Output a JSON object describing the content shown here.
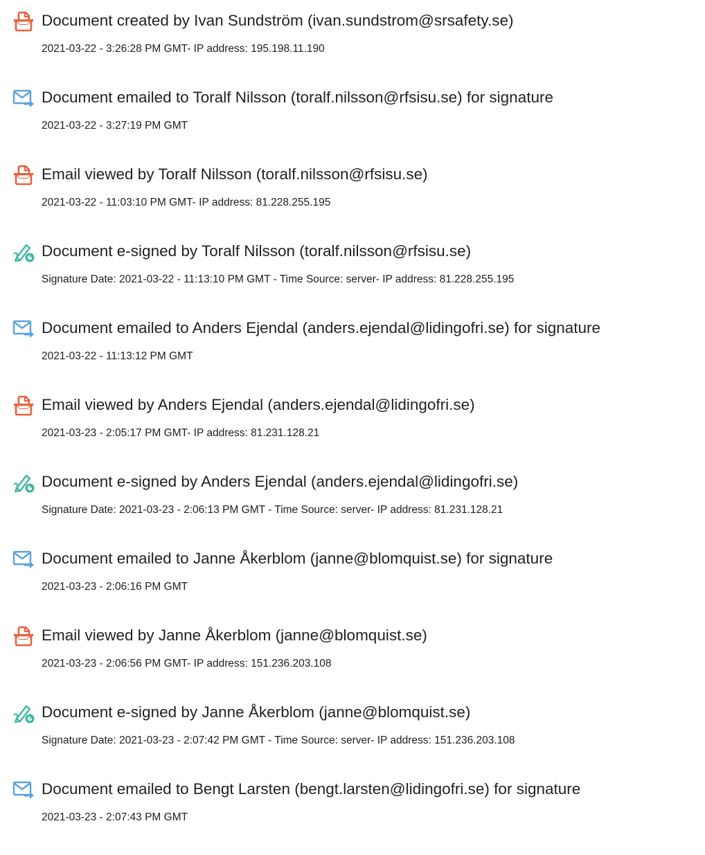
{
  "colors": {
    "created_icon": "#e8603c",
    "emailed_icon": "#5aa3dd",
    "signed_icon": "#3fb6a1",
    "text": "#222222"
  },
  "events": [
    {
      "type": "created",
      "icon": "document-created-icon",
      "title": "Document created by Ivan Sundström (ivan.sundstrom@srsafety.se)",
      "detail": "2021-03-22 - 3:26:28 PM GMT- IP address: 195.198.11.190"
    },
    {
      "type": "emailed",
      "icon": "envelope-arrow-icon",
      "title": "Document emailed to Toralf Nilsson (toralf.nilsson@rfsisu.se) for signature",
      "detail": "2021-03-22 - 3:27:19 PM GMT"
    },
    {
      "type": "viewed",
      "icon": "document-viewed-icon",
      "title": "Email viewed by Toralf Nilsson (toralf.nilsson@rfsisu.se)",
      "detail": "2021-03-22 - 11:03:10 PM GMT- IP address: 81.228.255.195"
    },
    {
      "type": "signed",
      "icon": "pen-signed-icon",
      "title": "Document e-signed by Toralf Nilsson (toralf.nilsson@rfsisu.se)",
      "detail": "Signature Date: 2021-03-22 - 11:13:10 PM GMT - Time Source: server- IP address: 81.228.255.195"
    },
    {
      "type": "emailed",
      "icon": "envelope-arrow-icon",
      "title": "Document emailed to Anders Ejendal (anders.ejendal@lidingofri.se) for signature",
      "detail": "2021-03-22 - 11:13:12 PM GMT"
    },
    {
      "type": "viewed",
      "icon": "document-viewed-icon",
      "title": "Email viewed by Anders Ejendal (anders.ejendal@lidingofri.se)",
      "detail": "2021-03-23 - 2:05:17 PM GMT- IP address: 81.231.128.21"
    },
    {
      "type": "signed",
      "icon": "pen-signed-icon",
      "title": "Document e-signed by Anders Ejendal (anders.ejendal@lidingofri.se)",
      "detail": "Signature Date: 2021-03-23 - 2:06:13 PM GMT - Time Source: server- IP address: 81.231.128.21"
    },
    {
      "type": "emailed",
      "icon": "envelope-arrow-icon",
      "title": "Document emailed to Janne Åkerblom (janne@blomquist.se) for signature",
      "detail": "2021-03-23 - 2:06:16 PM GMT"
    },
    {
      "type": "viewed",
      "icon": "document-viewed-icon",
      "title": "Email viewed by Janne Åkerblom (janne@blomquist.se)",
      "detail": "2021-03-23 - 2:06:56 PM GMT- IP address: 151.236.203.108"
    },
    {
      "type": "signed",
      "icon": "pen-signed-icon",
      "title": "Document e-signed by Janne Åkerblom (janne@blomquist.se)",
      "detail": "Signature Date: 2021-03-23 - 2:07:42 PM GMT - Time Source: server- IP address: 151.236.203.108"
    },
    {
      "type": "emailed",
      "icon": "envelope-arrow-icon",
      "title": "Document emailed to Bengt Larsten (bengt.larsten@lidingofri.se) for signature",
      "detail": "2021-03-23 - 2:07:43 PM GMT"
    }
  ]
}
